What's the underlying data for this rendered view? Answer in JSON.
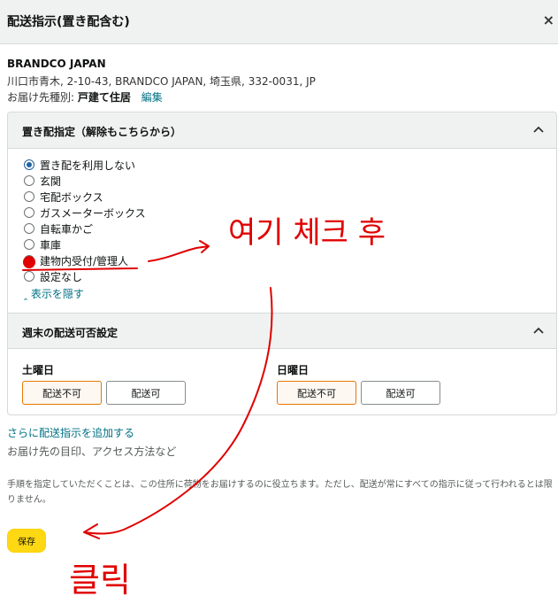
{
  "header": {
    "title": "配送指示(置き配含む)",
    "close": "×"
  },
  "address": {
    "name": "BRANDCO JAPAN",
    "line": "川口市青木, 2-10-43, BRANDCO JAPAN, 埼玉県, 332-0031, JP",
    "type_label": "お届け先種別:",
    "type_value": "戸建て住居",
    "edit": "編集"
  },
  "drop_section": {
    "title": "置き配指定（解除もこちらから）",
    "options": [
      {
        "label": "置き配を利用しない",
        "checked": true
      },
      {
        "label": "玄関",
        "checked": false
      },
      {
        "label": "宅配ボックス",
        "checked": false
      },
      {
        "label": "ガスメーターボックス",
        "checked": false
      },
      {
        "label": "自転車かご",
        "checked": false
      },
      {
        "label": "車庫",
        "checked": false
      },
      {
        "label": "建物内受付/管理人",
        "checked": false
      },
      {
        "label": "設定なし",
        "checked": false
      }
    ],
    "hide_link": "‸ 表示を隠す"
  },
  "weekend_section": {
    "title": "週末の配送可否設定",
    "saturday": {
      "label": "土曜日",
      "no": "配送不可",
      "yes": "配送可"
    },
    "sunday": {
      "label": "日曜日",
      "no": "配送不可",
      "yes": "配送可"
    }
  },
  "more": {
    "link": "さらに配送指示を追加する",
    "sub": "お届け先の目印、アクセス方法など"
  },
  "note": "手順を指定していただくことは、この住所に荷物をお届けするのに役立ちます。ただし、配送が常にすべての指示に従って行われるとは限りません。",
  "save_label": "保存",
  "annotation": {
    "color": "#e00000",
    "text_top": "여기 체크 후",
    "text_bottom": "클릭"
  }
}
